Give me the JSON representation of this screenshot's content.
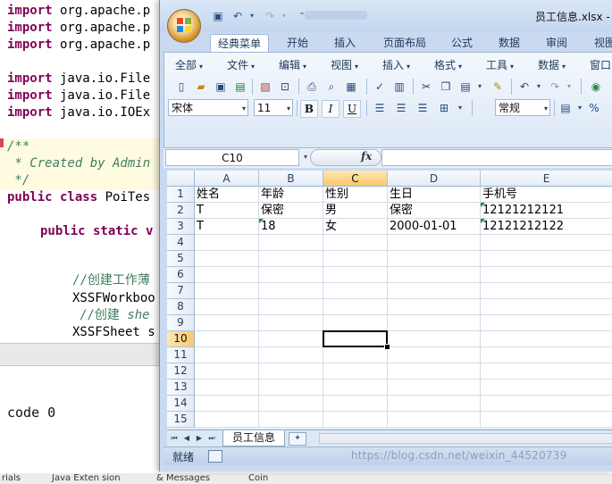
{
  "ide": {
    "code": {
      "l1": "import",
      "l1b": " org.apache.p",
      "l2": "import",
      "l2b": " org.apache.p",
      "l3": "import",
      "l3b": " org.apache.p",
      "l4": "import",
      "l4b": " java.io.File",
      "l5": "import",
      "l5b": " java.io.File",
      "l6": "import",
      "l6b": " java.io.IOEx",
      "l7": "/**",
      "l8": " * Created by Admin",
      "l9": " */",
      "l10a": "public class",
      "l10b": " PoiTes",
      "l11a": "public static",
      "l11b": " v",
      "l12": "//创建工作薄",
      "l13": "XSSFWorkboo",
      "l14a": "//创建 ",
      "l14b": "she",
      "l15": "XSSFSheet s"
    },
    "console": "code 0",
    "status": [
      "rials",
      "Java Exten sion",
      "& Messages",
      "Coin"
    ]
  },
  "excel": {
    "title": "员工信息.xlsx - 视",
    "ribbon_tabs": [
      "经典菜单",
      "开始",
      "插入",
      "页面布局",
      "公式",
      "数据",
      "审阅",
      "视图"
    ],
    "active_tab": "经典菜单",
    "menus": [
      "全部",
      "文件",
      "编辑",
      "视图",
      "插入",
      "格式",
      "工具",
      "数据",
      "窗口"
    ],
    "font_name": "宋体",
    "font_size": "11",
    "number_format": "常规",
    "fmt_buttons": {
      "bold": "B",
      "italic": "I",
      "underline": "U",
      "percent": "%"
    },
    "name_box": "C10",
    "fx": "fx",
    "columns": [
      "A",
      "B",
      "C",
      "D",
      "E"
    ],
    "selected_column": "C",
    "rows": [
      "1",
      "2",
      "3",
      "4",
      "5",
      "6",
      "7",
      "8",
      "9",
      "10",
      "11",
      "12",
      "13",
      "14",
      "15"
    ],
    "selected_row": "10",
    "cells": [
      [
        "姓名",
        "年龄",
        "性别",
        "生日",
        "手机号"
      ],
      [
        "T",
        "保密",
        "男",
        "保密",
        "12121212121"
      ],
      [
        "T",
        "18",
        "女",
        "2000-01-01",
        "12121212122"
      ]
    ],
    "sheet_tab": "员工信息",
    "status": "就绪",
    "watermark": "https://blog.csdn.net/weixin_44520739"
  }
}
